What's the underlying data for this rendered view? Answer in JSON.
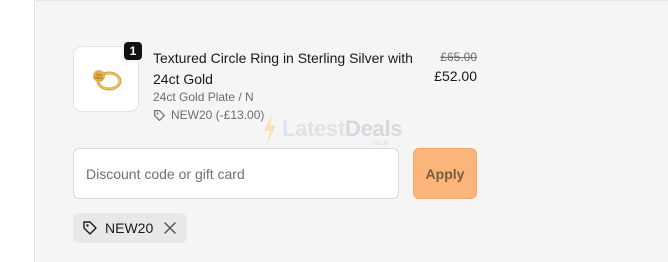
{
  "line_item": {
    "quantity": "1",
    "title": "Textured Circle Ring in Sterling Silver with 24ct Gold",
    "variant": "24ct Gold Plate / N",
    "discount_applied": "NEW20 (-£13.00)",
    "original_price": "£65.00",
    "sale_price": "£52.00",
    "thumbnail_icon": "gold-ring-image"
  },
  "watermark": {
    "brand_prefix": "Latest",
    "brand_suffix": "Deals",
    "domain": ".co.uk"
  },
  "discount_form": {
    "placeholder": "Discount code or gift card",
    "value": "",
    "apply_label": "Apply"
  },
  "applied_codes": [
    {
      "code": "NEW20"
    }
  ],
  "colors": {
    "panel_bg": "#f5f5f5",
    "apply_button": "#fbb57a",
    "chip_bg": "#e8e8e8",
    "badge_bg": "#111111"
  }
}
